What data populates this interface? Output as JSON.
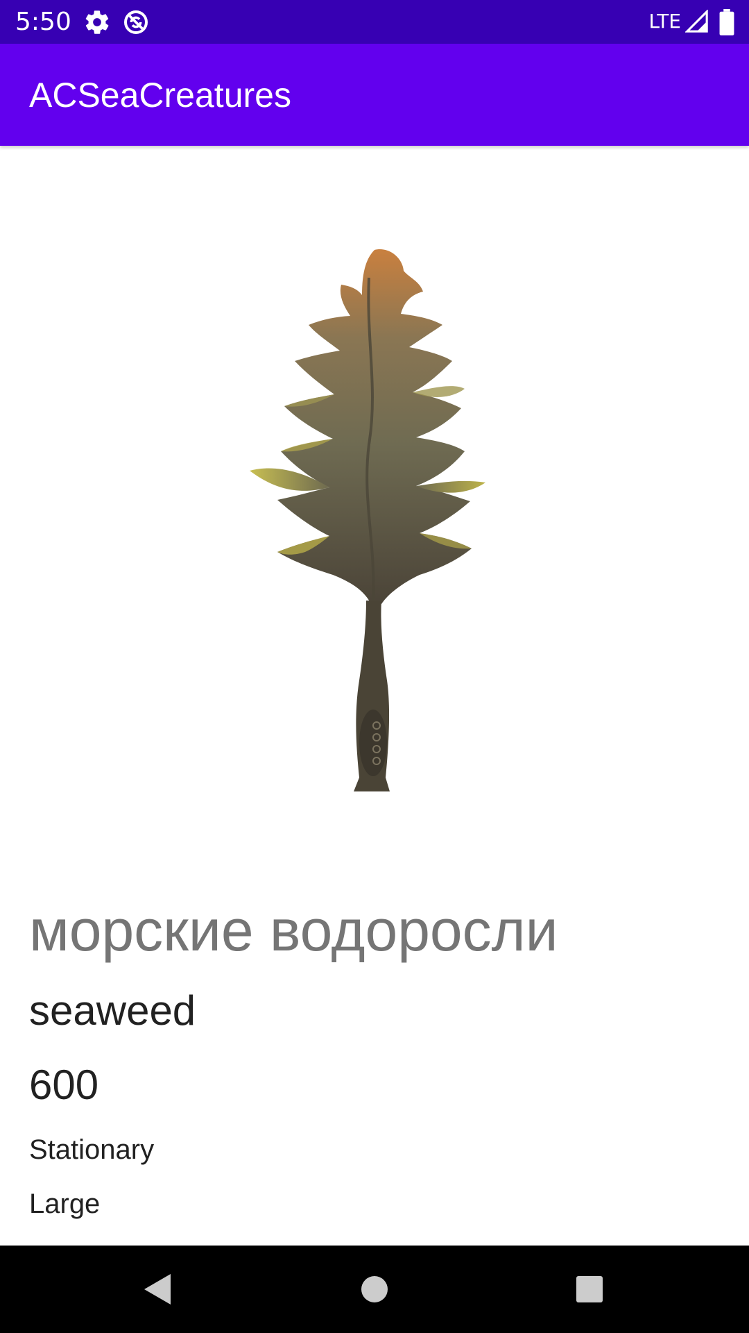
{
  "status_bar": {
    "time": "5:50",
    "network": "LTE",
    "icons": [
      "settings-icon",
      "sync-icon",
      "signal-icon",
      "battery-icon"
    ]
  },
  "app_bar": {
    "title": "ACSeaCreatures"
  },
  "creature": {
    "image_icon": "seaweed-illustration",
    "name_ru": "морские водоросли",
    "name_en": "seaweed",
    "price": "600",
    "movement": "Stationary",
    "size": "Large"
  },
  "nav_bar": {
    "buttons": [
      "back-icon",
      "home-icon",
      "recents-icon"
    ]
  },
  "colors": {
    "status_bar": "#3700b3",
    "app_bar": "#6200ee",
    "title_text": "#ffffff",
    "primary_text": "#212121",
    "secondary_text": "#757575",
    "nav_bar": "#000000"
  }
}
